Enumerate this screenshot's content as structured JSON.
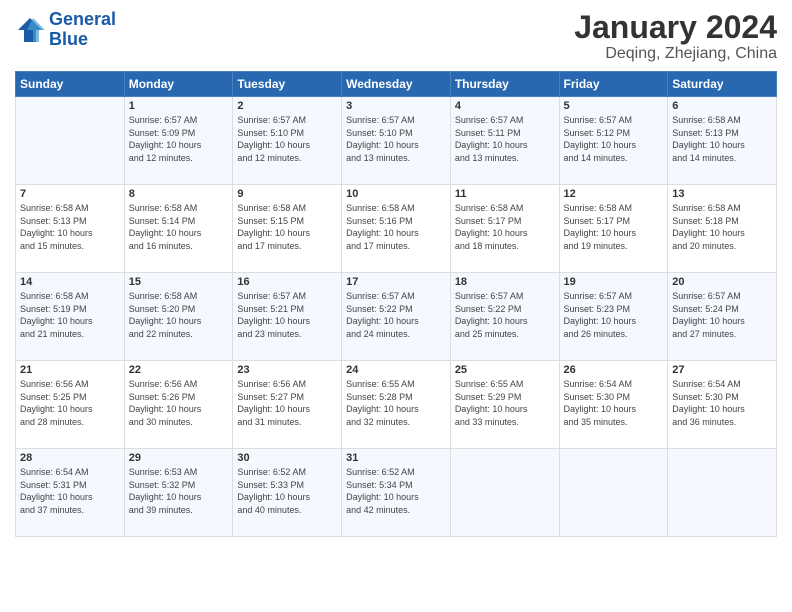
{
  "header": {
    "logo_line1": "General",
    "logo_line2": "Blue",
    "month": "January 2024",
    "location": "Deqing, Zhejiang, China"
  },
  "days_of_week": [
    "Sunday",
    "Monday",
    "Tuesday",
    "Wednesday",
    "Thursday",
    "Friday",
    "Saturday"
  ],
  "weeks": [
    [
      {
        "day": "",
        "info": ""
      },
      {
        "day": "1",
        "info": "Sunrise: 6:57 AM\nSunset: 5:09 PM\nDaylight: 10 hours\nand 12 minutes."
      },
      {
        "day": "2",
        "info": "Sunrise: 6:57 AM\nSunset: 5:10 PM\nDaylight: 10 hours\nand 12 minutes."
      },
      {
        "day": "3",
        "info": "Sunrise: 6:57 AM\nSunset: 5:10 PM\nDaylight: 10 hours\nand 13 minutes."
      },
      {
        "day": "4",
        "info": "Sunrise: 6:57 AM\nSunset: 5:11 PM\nDaylight: 10 hours\nand 13 minutes."
      },
      {
        "day": "5",
        "info": "Sunrise: 6:57 AM\nSunset: 5:12 PM\nDaylight: 10 hours\nand 14 minutes."
      },
      {
        "day": "6",
        "info": "Sunrise: 6:58 AM\nSunset: 5:13 PM\nDaylight: 10 hours\nand 14 minutes."
      }
    ],
    [
      {
        "day": "7",
        "info": "Sunrise: 6:58 AM\nSunset: 5:13 PM\nDaylight: 10 hours\nand 15 minutes."
      },
      {
        "day": "8",
        "info": "Sunrise: 6:58 AM\nSunset: 5:14 PM\nDaylight: 10 hours\nand 16 minutes."
      },
      {
        "day": "9",
        "info": "Sunrise: 6:58 AM\nSunset: 5:15 PM\nDaylight: 10 hours\nand 17 minutes."
      },
      {
        "day": "10",
        "info": "Sunrise: 6:58 AM\nSunset: 5:16 PM\nDaylight: 10 hours\nand 17 minutes."
      },
      {
        "day": "11",
        "info": "Sunrise: 6:58 AM\nSunset: 5:17 PM\nDaylight: 10 hours\nand 18 minutes."
      },
      {
        "day": "12",
        "info": "Sunrise: 6:58 AM\nSunset: 5:17 PM\nDaylight: 10 hours\nand 19 minutes."
      },
      {
        "day": "13",
        "info": "Sunrise: 6:58 AM\nSunset: 5:18 PM\nDaylight: 10 hours\nand 20 minutes."
      }
    ],
    [
      {
        "day": "14",
        "info": "Sunrise: 6:58 AM\nSunset: 5:19 PM\nDaylight: 10 hours\nand 21 minutes."
      },
      {
        "day": "15",
        "info": "Sunrise: 6:58 AM\nSunset: 5:20 PM\nDaylight: 10 hours\nand 22 minutes."
      },
      {
        "day": "16",
        "info": "Sunrise: 6:57 AM\nSunset: 5:21 PM\nDaylight: 10 hours\nand 23 minutes."
      },
      {
        "day": "17",
        "info": "Sunrise: 6:57 AM\nSunset: 5:22 PM\nDaylight: 10 hours\nand 24 minutes."
      },
      {
        "day": "18",
        "info": "Sunrise: 6:57 AM\nSunset: 5:22 PM\nDaylight: 10 hours\nand 25 minutes."
      },
      {
        "day": "19",
        "info": "Sunrise: 6:57 AM\nSunset: 5:23 PM\nDaylight: 10 hours\nand 26 minutes."
      },
      {
        "day": "20",
        "info": "Sunrise: 6:57 AM\nSunset: 5:24 PM\nDaylight: 10 hours\nand 27 minutes."
      }
    ],
    [
      {
        "day": "21",
        "info": "Sunrise: 6:56 AM\nSunset: 5:25 PM\nDaylight: 10 hours\nand 28 minutes."
      },
      {
        "day": "22",
        "info": "Sunrise: 6:56 AM\nSunset: 5:26 PM\nDaylight: 10 hours\nand 30 minutes."
      },
      {
        "day": "23",
        "info": "Sunrise: 6:56 AM\nSunset: 5:27 PM\nDaylight: 10 hours\nand 31 minutes."
      },
      {
        "day": "24",
        "info": "Sunrise: 6:55 AM\nSunset: 5:28 PM\nDaylight: 10 hours\nand 32 minutes."
      },
      {
        "day": "25",
        "info": "Sunrise: 6:55 AM\nSunset: 5:29 PM\nDaylight: 10 hours\nand 33 minutes."
      },
      {
        "day": "26",
        "info": "Sunrise: 6:54 AM\nSunset: 5:30 PM\nDaylight: 10 hours\nand 35 minutes."
      },
      {
        "day": "27",
        "info": "Sunrise: 6:54 AM\nSunset: 5:30 PM\nDaylight: 10 hours\nand 36 minutes."
      }
    ],
    [
      {
        "day": "28",
        "info": "Sunrise: 6:54 AM\nSunset: 5:31 PM\nDaylight: 10 hours\nand 37 minutes."
      },
      {
        "day": "29",
        "info": "Sunrise: 6:53 AM\nSunset: 5:32 PM\nDaylight: 10 hours\nand 39 minutes."
      },
      {
        "day": "30",
        "info": "Sunrise: 6:52 AM\nSunset: 5:33 PM\nDaylight: 10 hours\nand 40 minutes."
      },
      {
        "day": "31",
        "info": "Sunrise: 6:52 AM\nSunset: 5:34 PM\nDaylight: 10 hours\nand 42 minutes."
      },
      {
        "day": "",
        "info": ""
      },
      {
        "day": "",
        "info": ""
      },
      {
        "day": "",
        "info": ""
      }
    ]
  ]
}
